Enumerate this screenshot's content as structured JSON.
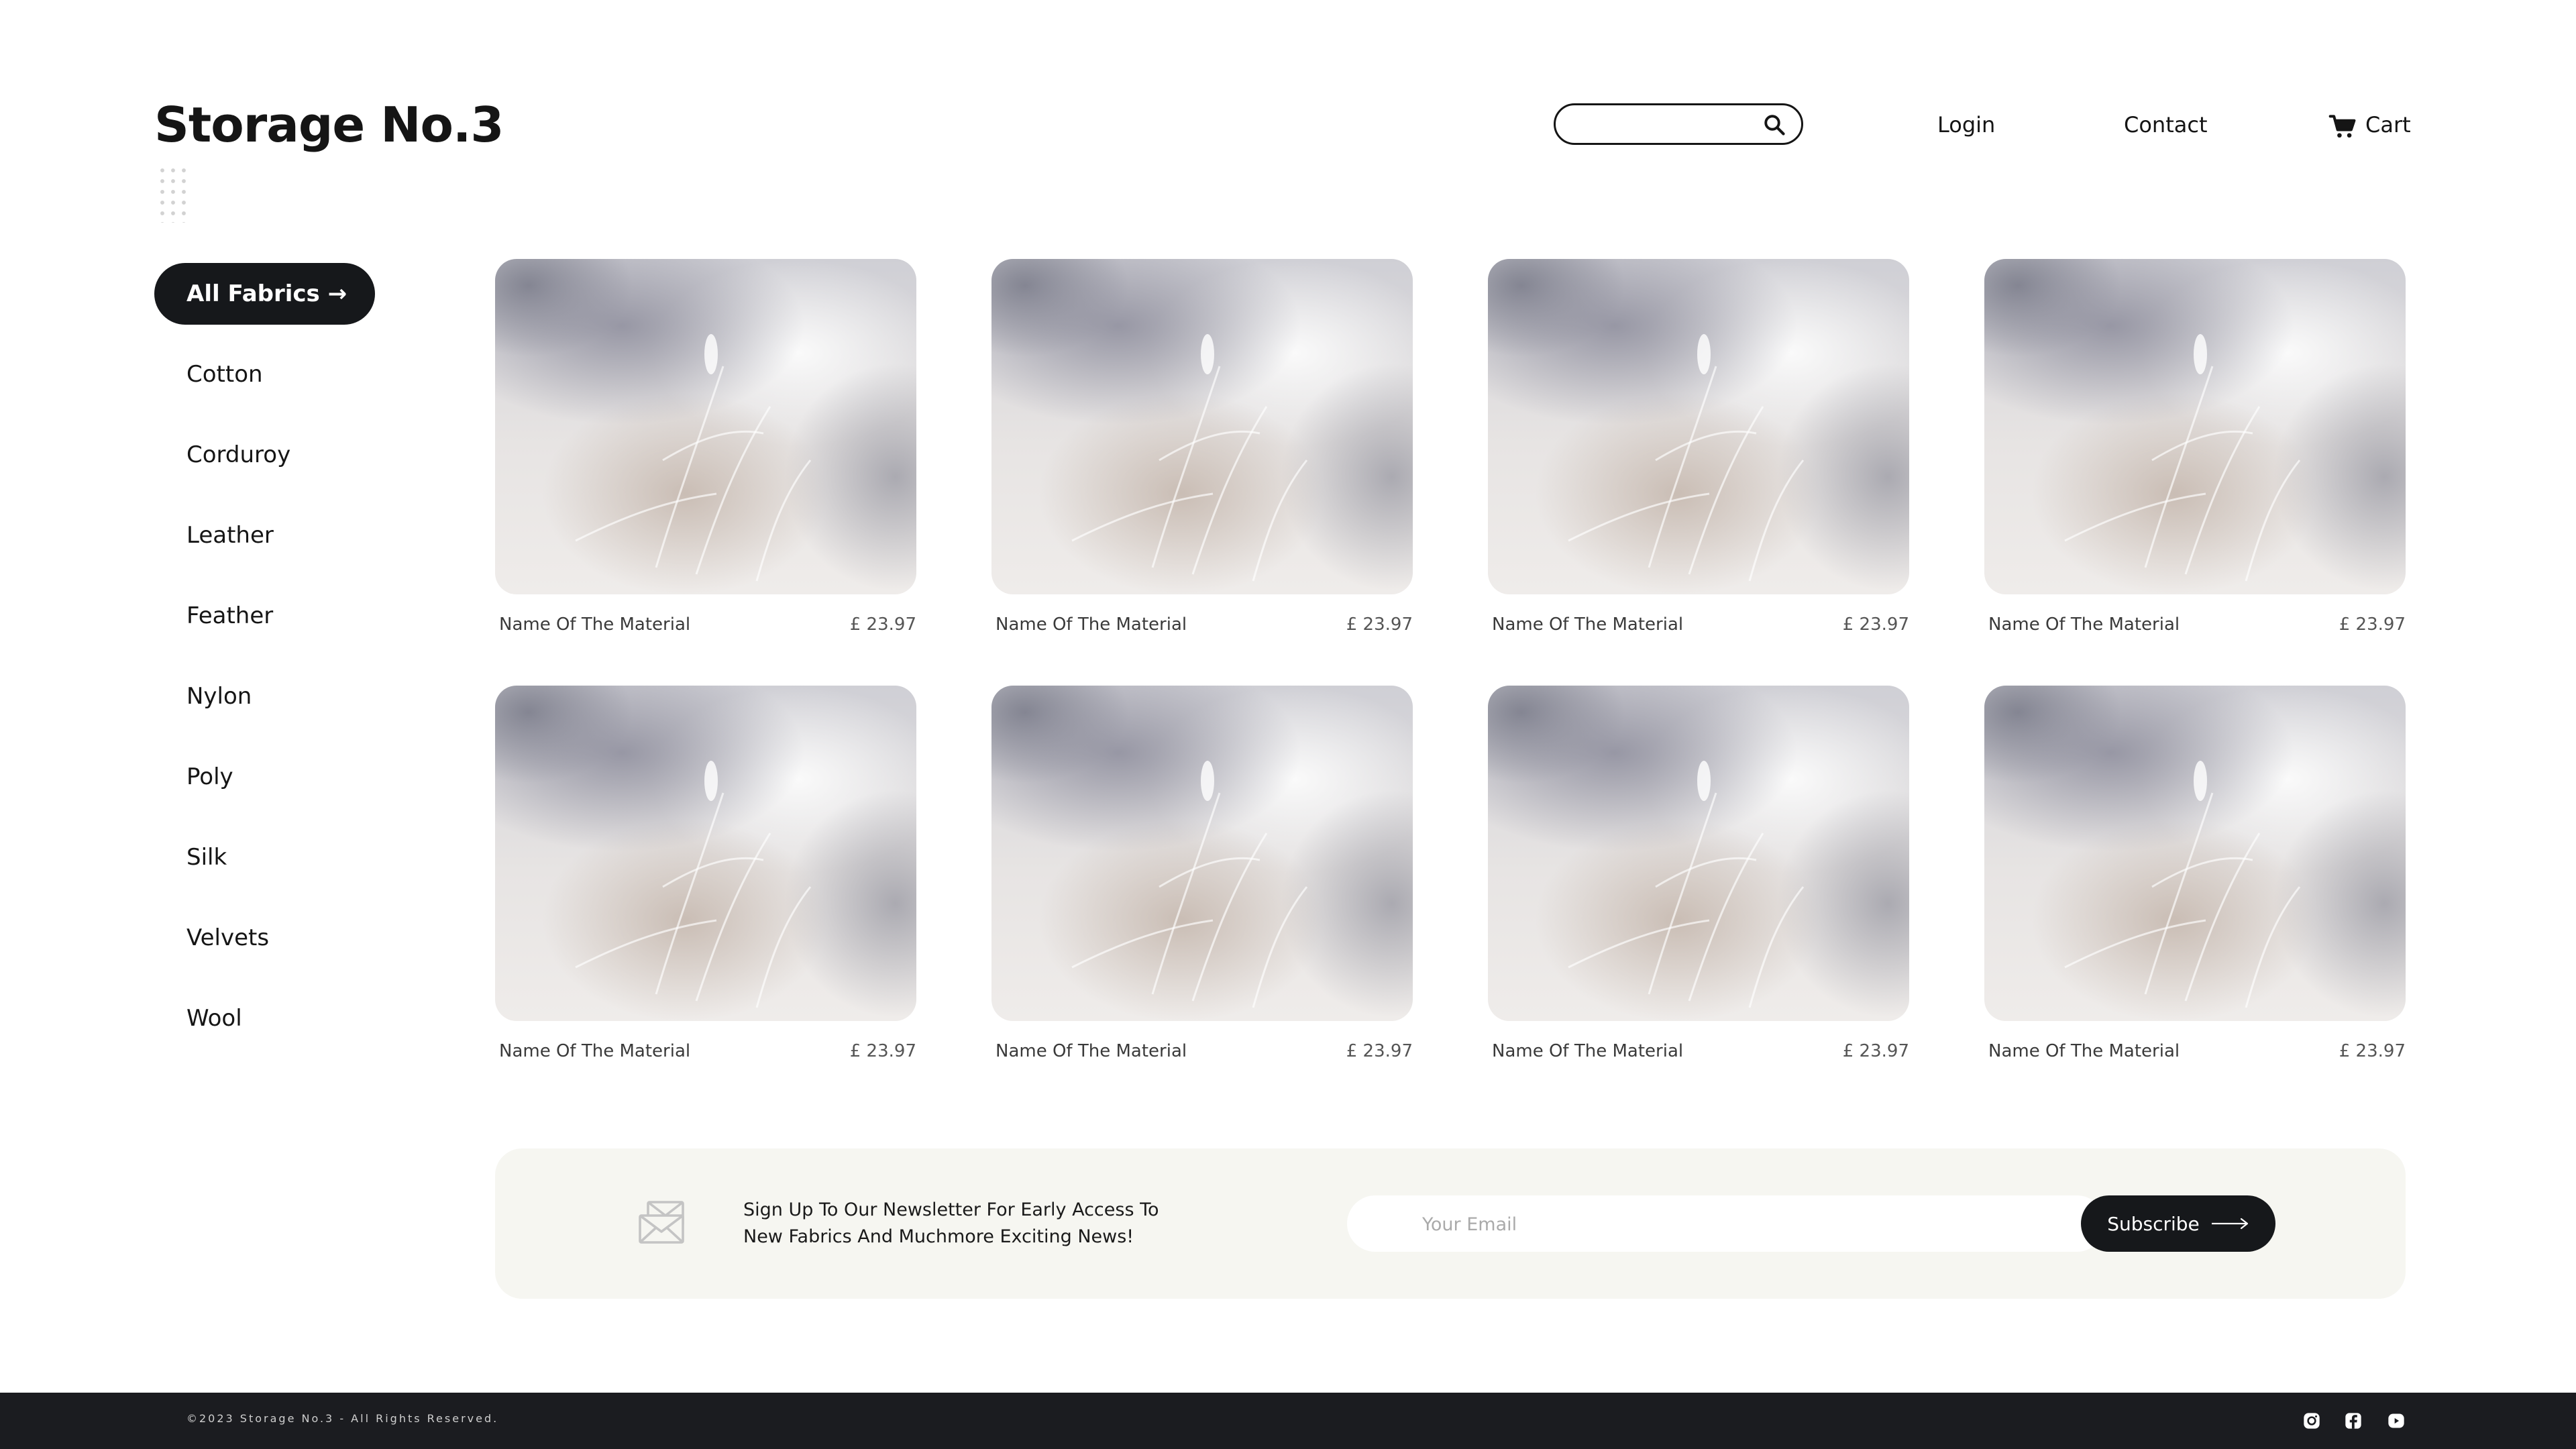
{
  "brand": {
    "name": "Storage No.3"
  },
  "header": {
    "search": {
      "value": "",
      "placeholder": ""
    },
    "nav": {
      "login": "Login",
      "contact": "Contact",
      "cart": "Cart"
    }
  },
  "sidebar": {
    "active": "All Fabrics →",
    "items": [
      "Cotton",
      "Corduroy",
      "Leather",
      "Feather",
      "Nylon",
      "Poly",
      "Silk",
      "Velvets",
      "Wool"
    ]
  },
  "products": [
    {
      "name": "Name Of The Material",
      "price": "£ 23.97"
    },
    {
      "name": "Name Of The Material",
      "price": "£ 23.97"
    },
    {
      "name": "Name Of The Material",
      "price": "£ 23.97"
    },
    {
      "name": "Name Of The Material",
      "price": "£ 23.97"
    },
    {
      "name": "Name Of The Material",
      "price": "£ 23.97"
    },
    {
      "name": "Name Of The Material",
      "price": "£ 23.97"
    },
    {
      "name": "Name Of The Material",
      "price": "£ 23.97"
    },
    {
      "name": "Name Of The Material",
      "price": "£ 23.97"
    }
  ],
  "newsletter": {
    "text": "Sign Up To Our Newsletter For Early Access To New Fabrics And Muchmore Exciting News!",
    "email_value": "",
    "email_placeholder": "Your Email",
    "subscribe_label": "Subscribe"
  },
  "footer": {
    "copyright": "©2023 Storage No.3 - All Rights Reserved."
  },
  "icons": {
    "search": "search-icon",
    "cart": "cart-icon",
    "mail": "mail-icon",
    "arrow": "arrow-right-icon",
    "instagram": "instagram-icon",
    "facebook": "facebook-icon",
    "youtube": "youtube-icon"
  },
  "colors": {
    "dark": "#16181b",
    "newsletter_bg": "#f6f6f1",
    "footer_bg": "#1b1c20",
    "text": "#151515"
  }
}
